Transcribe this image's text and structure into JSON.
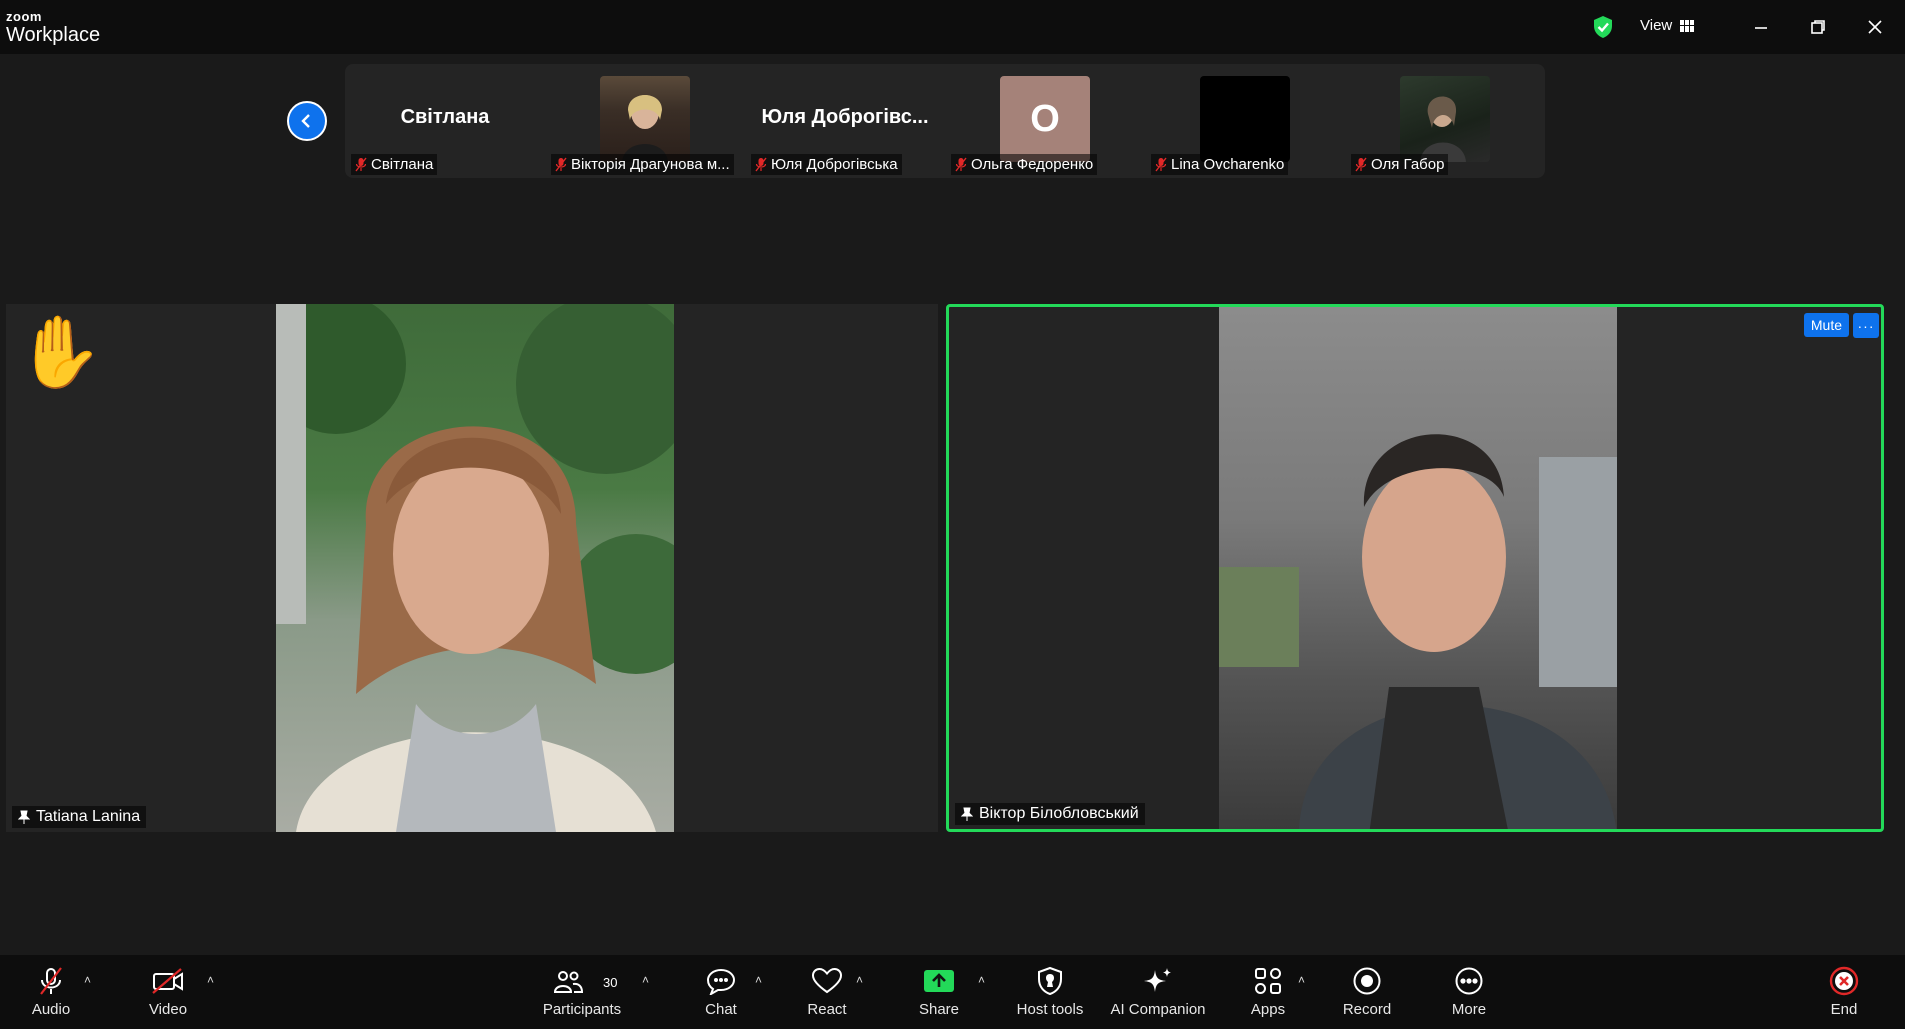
{
  "app": {
    "brand_small": "zoom",
    "brand_large": "Workplace",
    "view_label": "View"
  },
  "strip": {
    "participants": [
      {
        "big_name": "Світлана",
        "label": "Світлана",
        "type": "name"
      },
      {
        "big_name": "",
        "label": "Вікторія Драгунова м...",
        "type": "photo"
      },
      {
        "big_name": "Юля Доброгівс...",
        "label": "Юля Доброгівська",
        "type": "name"
      },
      {
        "big_name": "O",
        "label": "Ольга Федоренко",
        "type": "initial"
      },
      {
        "big_name": "",
        "label": "Lina Ovcharenko",
        "type": "black"
      },
      {
        "big_name": "",
        "label": "Оля Габор",
        "type": "photo"
      }
    ]
  },
  "tiles": {
    "left": {
      "name": "Tatiana Lanina",
      "hand": "✋"
    },
    "right": {
      "name": "Віктор Білобловський",
      "mute_label": "Mute",
      "more_label": "···"
    }
  },
  "toolbar": {
    "audio": "Audio",
    "video": "Video",
    "participants": "Participants",
    "participants_count": "30",
    "chat": "Chat",
    "react": "React",
    "share": "Share",
    "host_tools": "Host tools",
    "ai_companion": "AI Companion",
    "apps": "Apps",
    "record": "Record",
    "more": "More",
    "end": "End"
  },
  "colors": {
    "accent": "#0e72ed",
    "active_speaker": "#23d959",
    "end": "#e02828",
    "share": "#23d959"
  }
}
